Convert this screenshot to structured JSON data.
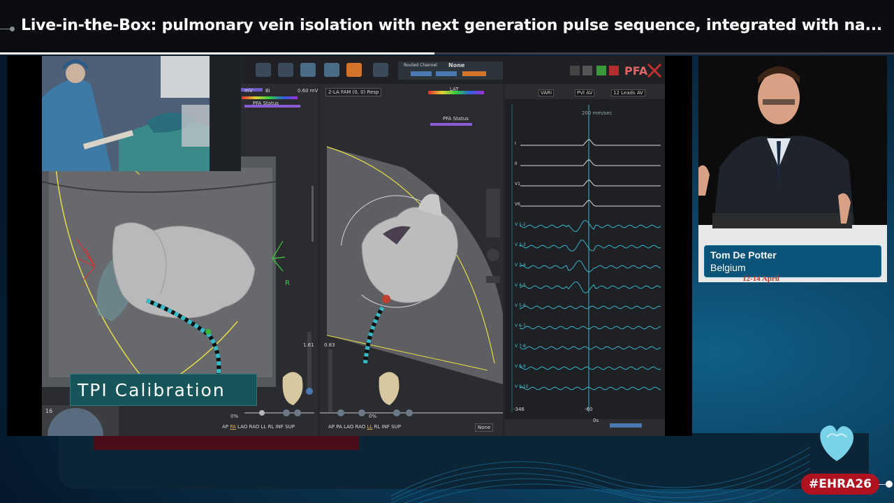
{
  "header": {
    "title": "Live-in-the-Box: pulmonary vein isolation with next generation pulse sequence, integrated with na...",
    "progress_fraction": 0.486
  },
  "cartography": {
    "toolbar": {
      "routed_channel_label": "Routed Channel",
      "routed_channel_value": "None",
      "pfa_logo": "PFA"
    },
    "left_view": {
      "units": "mV",
      "map_type": "Bi",
      "scale_max": "0.60 mV",
      "status_label": "PFA Status",
      "orientation_left": "L",
      "orientation_right": "R",
      "slider_value": "1.61",
      "opacity": "0%",
      "projection": "PA",
      "view_buttons": [
        "AP",
        "PA",
        "LAO",
        "RAO",
        "LL",
        "RL",
        "INF",
        "SUP"
      ],
      "counter": "16"
    },
    "mid_view": {
      "map_name": "2-LA FAM (0, 0) Resp",
      "map_type": "LAT",
      "status_label": "PFA Status",
      "slider_value": "0.83",
      "opacity": "0%",
      "projection": "LL",
      "view_buttons": [
        "AP",
        "PA",
        "LAO",
        "RAO",
        "LL",
        "RL",
        "INF",
        "SUP"
      ],
      "dropdown": "None"
    },
    "ecg": {
      "dropdowns": [
        "VARI",
        "PVI AV",
        "12 Leads AV"
      ],
      "time_marker": "200 mm/sec",
      "leads": [
        "I",
        "II",
        "V1",
        "V6",
        "V 1-2",
        "V 2-3",
        "V 3-4",
        "V 4-5",
        "V 5-6",
        "V 6-7",
        "V 7-8",
        "V 8-9",
        "V 9-10"
      ],
      "lead_prefix_r": "R",
      "lead_prefix_m": "M",
      "axis_left": "-346",
      "axis_mid": "-60",
      "axis_bottom": "0s"
    },
    "overlay_banner": "TPI Calibration"
  },
  "speaker": {
    "name": "Tom De Potter",
    "country": "Belgium",
    "date": "12-14 April"
  },
  "branding": {
    "hashtag": "#EHRA26"
  },
  "colors": {
    "hashtag_bg": "#b1121f",
    "lower_third_bg": "#0b5479",
    "banner_bg": "#16565a",
    "ecg_trace": "#38b6c8"
  }
}
